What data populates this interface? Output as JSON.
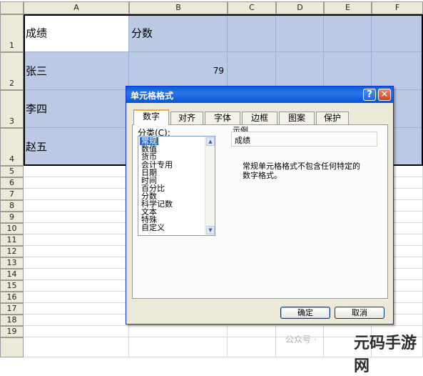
{
  "columns": [
    "A",
    "B",
    "C",
    "D",
    "E",
    "F"
  ],
  "rows": [
    "1",
    "2",
    "3",
    "4",
    "5",
    "6",
    "7",
    "8",
    "9",
    "10",
    "11",
    "12",
    "13",
    "14",
    "15",
    "16",
    "17",
    "18",
    "19"
  ],
  "cells": {
    "a1": "成绩",
    "b1": "分数",
    "a2": "张三",
    "b2": "79",
    "a3": "李四",
    "a4": "赵五"
  },
  "dialog": {
    "title": "单元格格式",
    "help": "?",
    "close": "✕",
    "tabs": [
      "数字",
      "对齐",
      "字体",
      "边框",
      "图案",
      "保护"
    ],
    "category_label": "分类(C):",
    "categories": [
      "常规",
      "数值",
      "货币",
      "会计专用",
      "日期",
      "时间",
      "百分比",
      "分数",
      "科学记数",
      "文本",
      "特殊",
      "自定义"
    ],
    "selected_category": "常规",
    "sample_label": "示例",
    "sample_value": "成绩",
    "description": "常规单元格格式不包含任何特定的数字格式。",
    "ok_label": "确定",
    "cancel_label": "取消"
  },
  "watermark": {
    "channel": "公众号 ·",
    "brand": "元码手游网"
  },
  "colors": {
    "selection": "#bcc9e4",
    "titlebar": "#0a5fd8",
    "header": "#ece9d8",
    "list_selected": "#316ac5"
  }
}
